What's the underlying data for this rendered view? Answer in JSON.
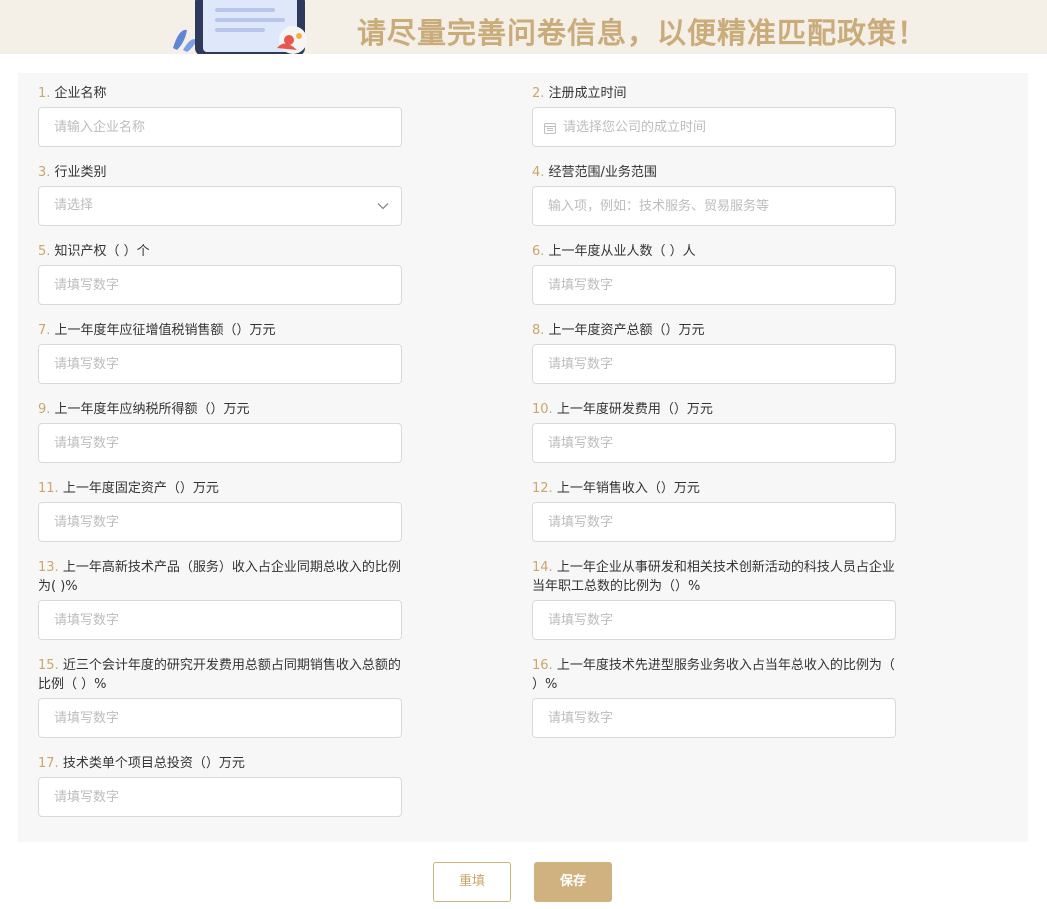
{
  "banner": {
    "text": "请尽量完善问卷信息，以便精准匹配政策！"
  },
  "colors": {
    "accent": "#cfb27f",
    "number": "#c8a86b",
    "panel": "#f7f7f7",
    "banner_bg": "#f4efe7"
  },
  "fields": [
    {
      "num": "1.",
      "label": "企业名称",
      "placeholder": "请输入企业名称"
    },
    {
      "num": "2.",
      "label": "注册成立时间",
      "placeholder": "请选择您公司的成立时间",
      "icon": "calendar-icon"
    },
    {
      "num": "3.",
      "label": "行业类别",
      "placeholder": "请选择",
      "icon": "chevron-down-icon"
    },
    {
      "num": "4.",
      "label": "经营范围/业务范围",
      "placeholder": "输入项，例如：技术服务、贸易服务等"
    },
    {
      "num": "5.",
      "label": "知识产权（ ）个",
      "placeholder": "请填写数字"
    },
    {
      "num": "6.",
      "label": "上一年度从业人数（ ）人",
      "placeholder": "请填写数字"
    },
    {
      "num": "7.",
      "label": "上一年度年应征增值税销售额（）万元",
      "placeholder": "请填写数字"
    },
    {
      "num": "8.",
      "label": "上一年度资产总额（）万元",
      "placeholder": "请填写数字"
    },
    {
      "num": "9.",
      "label": "上一年度年应纳税所得额（）万元",
      "placeholder": "请填写数字"
    },
    {
      "num": "10.",
      "label": "上一年度研发费用（）万元",
      "placeholder": "请填写数字"
    },
    {
      "num": "11.",
      "label": "上一年度固定资产（）万元",
      "placeholder": "请填写数字"
    },
    {
      "num": "12.",
      "label": "上一年销售收入（）万元",
      "placeholder": "请填写数字"
    },
    {
      "num": "13.",
      "label": "上一年高新技术产品（服务）收入占企业同期总收入的比例为( )%",
      "placeholder": "请填写数字"
    },
    {
      "num": "14.",
      "label": "上一年企业从事研发和相关技术创新活动的科技人员占企业当年职工总数的比例为（）%",
      "placeholder": "请填写数字"
    },
    {
      "num": "15.",
      "label": "近三个会计年度的研究开发费用总额占同期销售收入总额的比例（ ）%",
      "placeholder": "请填写数字"
    },
    {
      "num": "16.",
      "label": "上一年度技术先进型服务业务收入占当年总收入的比例为（ ）%",
      "placeholder": "请填写数字"
    },
    {
      "num": "17.",
      "label": "技术类单个项目总投资（）万元",
      "placeholder": "请填写数字"
    }
  ],
  "buttons": {
    "reset": "重填",
    "save": "保存"
  }
}
